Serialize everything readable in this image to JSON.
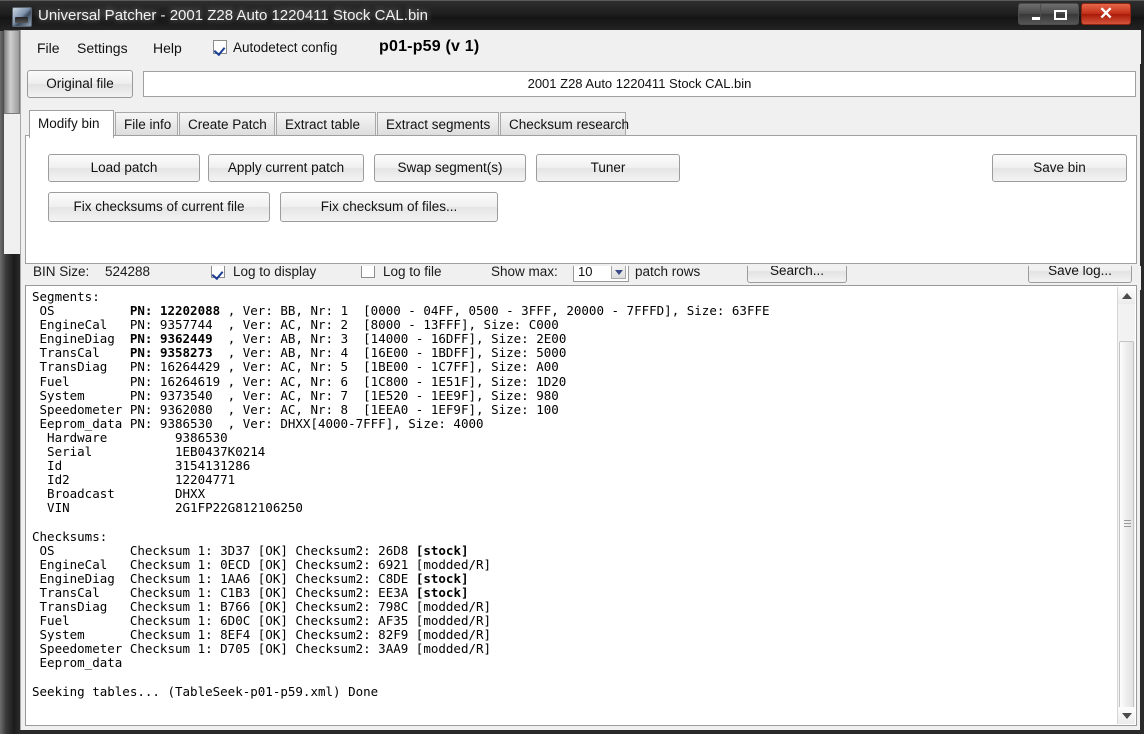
{
  "window": {
    "title": "Universal Patcher - 2001 Z28 Auto 1220411 Stock CAL.bin",
    "icon": "app-icon",
    "buttons": {
      "minimize": "minimize-icon",
      "maximize": "maximize-icon",
      "close": "✕"
    }
  },
  "menu": {
    "file": "File",
    "settings": "Settings",
    "help": "Help",
    "autodetect_label": "Autodetect config",
    "autodetect_checked": true,
    "config_version": "p01-p59 (v 1)"
  },
  "file_row": {
    "original_file_button": "Original file",
    "file_path_value": "2001 Z28 Auto 1220411 Stock CAL.bin"
  },
  "tabs": [
    {
      "label": "Modify bin",
      "active": true
    },
    {
      "label": "File info",
      "active": false
    },
    {
      "label": "Create Patch",
      "active": false
    },
    {
      "label": "Extract table",
      "active": false
    },
    {
      "label": "Extract segments",
      "active": false
    },
    {
      "label": "Checksum research",
      "active": false
    }
  ],
  "modify_bin": {
    "load_patch": "Load patch",
    "apply_current_patch": "Apply current patch",
    "swap_segments": "Swap segment(s)",
    "tuner": "Tuner",
    "save_bin": "Save bin",
    "fix_checksums_current": "Fix checksums of current file",
    "fix_checksum_files": "Fix checksum of files..."
  },
  "status_bar": {
    "bin_size_label": "BIN Size:",
    "bin_size_value": "524288",
    "log_to_display_label": "Log to display",
    "log_to_display_checked": true,
    "log_to_file_label": "Log to file",
    "log_to_file_checked": false,
    "show_max_label": "Show max:",
    "show_max_value": "10",
    "patch_rows_label": "patch rows",
    "search_button": "Search...",
    "save_log_button": "Save log..."
  },
  "log": {
    "segments_header": "Segments:",
    "segments": [
      {
        "name": "OS",
        "pn": "12202088",
        "pn_bold": true,
        "ver": "BB",
        "nr": "1",
        "range": "[0000 - 04FF, 0500 - 3FFF, 20000 - 7FFFD]",
        "size": "63FFE"
      },
      {
        "name": "EngineCal",
        "pn": "9357744",
        "pn_bold": false,
        "ver": "AC",
        "nr": "2",
        "range": "[8000 - 13FFF]",
        "size": "C000"
      },
      {
        "name": "EngineDiag",
        "pn": "9362449",
        "pn_bold": true,
        "ver": "AB",
        "nr": "3",
        "range": "[14000 - 16DFF]",
        "size": "2E00"
      },
      {
        "name": "TransCal",
        "pn": "9358273",
        "pn_bold": true,
        "ver": "AB",
        "nr": "4",
        "range": "[16E00 - 1BDFF]",
        "size": "5000"
      },
      {
        "name": "TransDiag",
        "pn": "16264429",
        "pn_bold": false,
        "ver": "AC",
        "nr": "5",
        "range": "[1BE00 - 1C7FF]",
        "size": "A00"
      },
      {
        "name": "Fuel",
        "pn": "16264619",
        "pn_bold": false,
        "ver": "AC",
        "nr": "6",
        "range": "[1C800 - 1E51F]",
        "size": "1D20"
      },
      {
        "name": "System",
        "pn": "9373540",
        "pn_bold": false,
        "ver": "AC",
        "nr": "7",
        "range": "[1E520 - 1EE9F]",
        "size": "980"
      },
      {
        "name": "Speedometer",
        "pn": "9362080",
        "pn_bold": false,
        "ver": "AC",
        "nr": "8",
        "range": "[1EEA0 - 1EF9F]",
        "size": "100"
      }
    ],
    "eeprom_line": {
      "name": "Eeprom_data",
      "pn": "9386530",
      "ver": "DHXX",
      "range": "[4000-7FFF]",
      "size": "4000"
    },
    "info": [
      {
        "label": "Hardware",
        "value": "9386530"
      },
      {
        "label": "Serial",
        "value": "1EB0437K0214"
      },
      {
        "label": "Id",
        "value": "3154131286"
      },
      {
        "label": "Id2",
        "value": "12204771"
      },
      {
        "label": "Broadcast",
        "value": "DHXX"
      },
      {
        "label": "VIN",
        "value": "2G1FP22G812106250"
      }
    ],
    "checksums_header": "Checksums:",
    "checksums": [
      {
        "name": "OS",
        "cs1": "3D37",
        "ok": "[OK]",
        "cs2": "26D8",
        "status": "[stock]",
        "status_bold": true
      },
      {
        "name": "EngineCal",
        "cs1": "0ECD",
        "ok": "[OK]",
        "cs2": "6921",
        "status": "[modded/R]",
        "status_bold": false
      },
      {
        "name": "EngineDiag",
        "cs1": "1AA6",
        "ok": "[OK]",
        "cs2": "C8DE",
        "status": "[stock]",
        "status_bold": true
      },
      {
        "name": "TransCal",
        "cs1": "C1B3",
        "ok": "[OK]",
        "cs2": "EE3A",
        "status": "[stock]",
        "status_bold": true
      },
      {
        "name": "TransDiag",
        "cs1": "B766",
        "ok": "[OK]",
        "cs2": "798C",
        "status": "[modded/R]",
        "status_bold": false
      },
      {
        "name": "Fuel",
        "cs1": "6D0C",
        "ok": "[OK]",
        "cs2": "AF35",
        "status": "[modded/R]",
        "status_bold": false
      },
      {
        "name": "System",
        "cs1": "8EF4",
        "ok": "[OK]",
        "cs2": "82F9",
        "status": "[modded/R]",
        "status_bold": false
      },
      {
        "name": "Speedometer",
        "cs1": "D705",
        "ok": "[OK]",
        "cs2": "3AA9",
        "status": "[modded/R]",
        "status_bold": false
      }
    ],
    "checksum_last": "Eeprom_data",
    "seeking_line": "Seeking tables... (TableSeek-p01-p59.xml) Done"
  },
  "colors": {
    "titlebar": "#1d1d1d",
    "close_button": "#c3301a",
    "panel": "#f0f0f0",
    "field": "#ffffff"
  }
}
